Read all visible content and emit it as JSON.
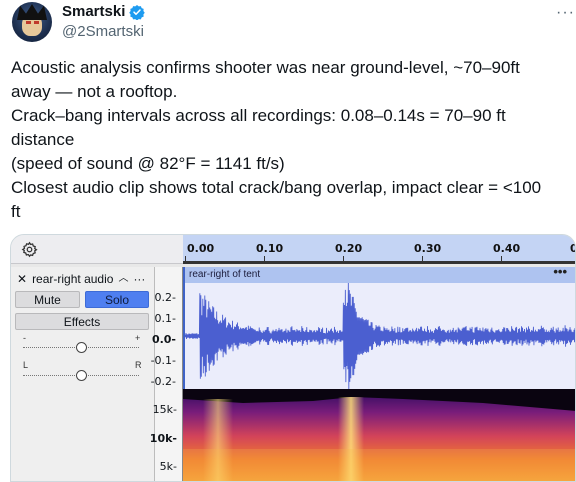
{
  "tweet": {
    "display_name": "Smartski",
    "handle": "@2Smartski",
    "lines": [
      "Acoustic analysis confirms shooter was near ground-level, ~70–90ft",
      "away — not a rooftop.",
      "Crack–bang intervals across all recordings: 0.08–0.14s = 70–90 ft",
      "distance",
      "(speed of sound @ 82°F = 1141 ft/s)",
      "Closest audio clip shows total crack/bang overlap, impact clear = <100",
      "ft"
    ]
  },
  "editor": {
    "timeline_ticks": [
      "0.00",
      "0.10",
      "0.20",
      "0.30",
      "0.40",
      "0"
    ],
    "track": {
      "name": "rear-right audio",
      "mute_label": "Mute",
      "solo_label": "Solo",
      "effects_label": "Effects",
      "gain_minus": "-",
      "gain_plus": "+",
      "pan_left": "L",
      "pan_right": "R"
    },
    "clip_name": "rear-right of tent",
    "clip_menu": "•••",
    "amplitude_labels": [
      "0.2-",
      "0.1-",
      "0.0-",
      "-0.1-",
      "-0.2-"
    ],
    "spectrogram_labels": [
      "15k-",
      "10k-",
      "5k-"
    ],
    "colors": {
      "ruler": "#c4d4f4",
      "waveform": "#4b5fd0",
      "solo_button": "#4f7ff0",
      "verified": "#1d9bf0"
    }
  }
}
